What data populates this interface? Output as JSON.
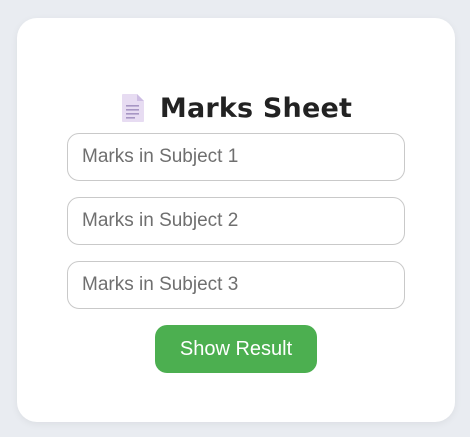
{
  "app": {
    "title": "Marks Sheet",
    "title_icon": "document-icon"
  },
  "form": {
    "fields": [
      {
        "placeholder": "Marks in Subject 1",
        "value": ""
      },
      {
        "placeholder": "Marks in Subject 2",
        "value": ""
      },
      {
        "placeholder": "Marks in Subject 3",
        "value": ""
      }
    ],
    "submit_label": "Show Result"
  },
  "colors": {
    "page_background": "#e9ecf1",
    "card_background": "#ffffff",
    "button": "#4caf50",
    "title_text": "#222222"
  }
}
